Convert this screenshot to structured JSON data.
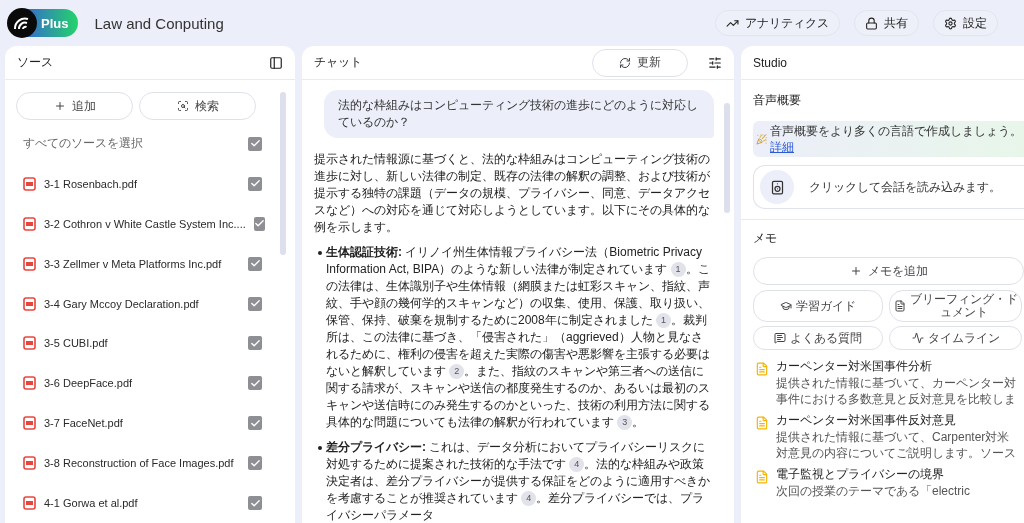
{
  "header": {
    "badge": "Plus",
    "title": "Law and Conputing",
    "actions": [
      {
        "kind": "analytics",
        "label": "アナリティクス"
      },
      {
        "kind": "share",
        "label": "共有"
      },
      {
        "kind": "settings",
        "label": "設定"
      }
    ]
  },
  "sources": {
    "title": "ソース",
    "add": "追加",
    "search": "検索",
    "select_all": {
      "label": "すべてのソースを選択",
      "checked": true
    },
    "items": [
      {
        "name": "3-1 Rosenbach.pdf",
        "checked": true
      },
      {
        "name": "3-2 Cothron v White Castle System Inc....",
        "checked": true
      },
      {
        "name": "3-3 Zellmer v Meta Platforms Inc.pdf",
        "checked": true
      },
      {
        "name": "3-4 Gary Mccoy Declaration.pdf",
        "checked": true
      },
      {
        "name": "3-5 CUBI.pdf",
        "checked": true
      },
      {
        "name": "3-6 DeepFace.pdf",
        "checked": true
      },
      {
        "name": "3-7 FaceNet.pdf",
        "checked": true
      },
      {
        "name": "3-8 Reconstruction of Face Images.pdf",
        "checked": true
      },
      {
        "name": "4-1 Gorwa et al.pdf",
        "checked": true
      }
    ]
  },
  "chat": {
    "title": "チャット",
    "refresh": "更新",
    "question": "法的な枠組みはコンピューティング技術の進歩にどのように対応しているのか？",
    "intro": "提示された情報源に基づくと、法的な枠組みはコンピューティング技術の進歩に対し、新しい法律の制定、既存の法律の解釈の調整、および技術が提示する独特の課題（データの規模、プライバシー、同意、データアクセスなど）への対応を通じて対応しようとしています。以下にその具体的な例を示します。",
    "bullets": [
      {
        "title": "生体認証技術:",
        "parts": [
          {
            "kind": "text",
            "text": " イリノイ州生体情報プライバシー法（Biometric Privacy Information Act, BIPA）のような新しい法律が制定されています "
          },
          {
            "kind": "cite",
            "text": "1"
          },
          {
            "kind": "text",
            "text": "。この法律は、生体識別子や生体情報（網膜または虹彩スキャン、指紋、声紋、手や顔の幾何学的スキャンなど）の収集、使用、保護、取り扱い、保管、保持、破棄を規制するために2008年に制定されました "
          },
          {
            "kind": "cite",
            "text": "1"
          },
          {
            "kind": "text",
            "text": "。裁判所は、この法律に基づき、「侵害された」（aggrieved）人物と見なされるために、権利の侵害を超えた実際の傷害や悪影響を主張する必要はないと解釈しています "
          },
          {
            "kind": "cite",
            "text": "2"
          },
          {
            "kind": "text",
            "text": "。また、指紋のスキャンや第三者への送信に関する請求が、スキャンや送信の都度発生するのか、あるいは最初のスキャンや送信時にのみ発生するのかといった、技術の利用方法に関する具体的な問題についても法律の解釈が行われています "
          },
          {
            "kind": "cite",
            "text": "3"
          },
          {
            "kind": "text",
            "text": "。"
          }
        ]
      },
      {
        "title": "差分プライバシー:",
        "parts": [
          {
            "kind": "text",
            "text": " これは、データ分析においてプライバシーリスクに対処するために提案された技術的な手法です "
          },
          {
            "kind": "cite",
            "text": "4"
          },
          {
            "kind": "text",
            "text": "。法的な枠組みや政策決定者は、差分プライバシーが提供する保証をどのように適用すべきかを考慮することが推奨されています "
          },
          {
            "kind": "cite",
            "text": "4"
          },
          {
            "kind": "text",
            "text": "。差分プライバシーでは、プライバシーパラメータ"
          }
        ]
      }
    ]
  },
  "studio": {
    "title": "Studio",
    "audio_title": "音声概要",
    "banner": "音声概要をより多くの言語で作成しましょう。",
    "banner_link": "詳細",
    "audio_card": "クリックして会話を読み込みます。",
    "memo_title": "メモ",
    "add_memo": "メモを追加",
    "tools": [
      {
        "kind": "guide",
        "lines": [
          "学習ガイド"
        ]
      },
      {
        "kind": "briefing",
        "lines": [
          "ブリーフィング・ド",
          "ュメント"
        ]
      },
      {
        "kind": "faq",
        "lines": [
          "よくある質問"
        ]
      },
      {
        "kind": "timeline",
        "lines": [
          "タイムライン"
        ]
      }
    ],
    "notes": [
      {
        "title": "カーペンター対米国事件分析",
        "lines": [
          "提供された情報に基づいて、カーペンター対",
          "事件における多数意見と反対意見を比較しま"
        ]
      },
      {
        "title": "カーペンター対米国事件反対意見",
        "lines": [
          "提供された情報に基づいて、Carpenter対米",
          "対意見の内容についてご説明します。ソース"
        ]
      },
      {
        "title": "電子監視とプライバシーの境界",
        "lines": [
          "次回の授業のテーマである「electric"
        ]
      }
    ]
  }
}
